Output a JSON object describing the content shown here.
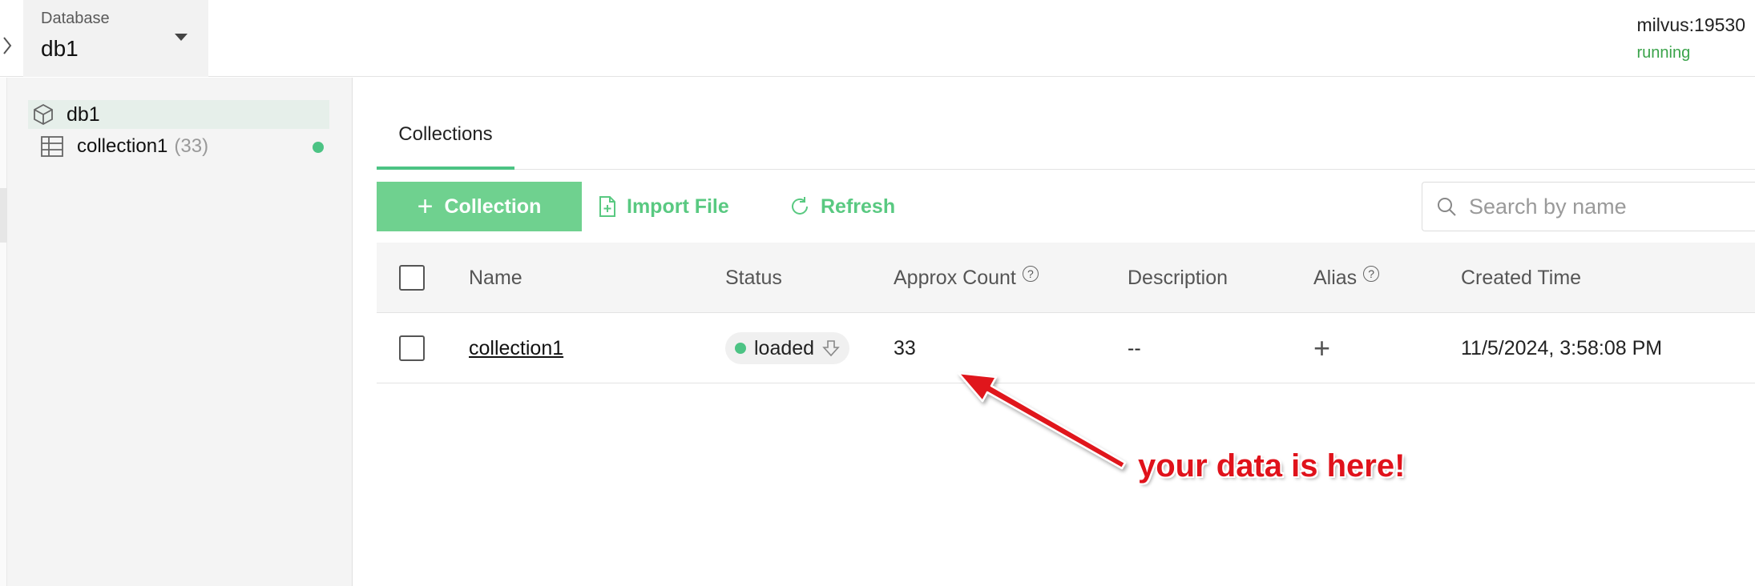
{
  "header": {
    "database_label": "Database",
    "database_value": "db1",
    "server_host": "milvus:19530",
    "server_status": "running"
  },
  "tree": {
    "database": "db1",
    "collections": [
      {
        "name": "collection1",
        "count": "(33)"
      }
    ]
  },
  "main": {
    "tab": "Collections",
    "toolbar": {
      "add_label": "Collection",
      "import_label": "Import File",
      "refresh_label": "Refresh",
      "search_placeholder": "Search by name"
    },
    "table": {
      "headers": {
        "name": "Name",
        "status": "Status",
        "count": "Approx Count",
        "description": "Description",
        "alias": "Alias",
        "created": "Created Time"
      },
      "rows": [
        {
          "name": "collection1",
          "status": "loaded",
          "count": "33",
          "description": "--",
          "created": "11/5/2024, 3:58:08 PM"
        }
      ]
    }
  },
  "annotation": {
    "text": "your data is here!"
  },
  "colors": {
    "accent": "#6fd18f",
    "accent_text": "#59c981",
    "loaded_dot": "#4cc384",
    "running": "#3aa34a",
    "annotation": "#e0121b"
  },
  "icons": {
    "collapse": "chevron-right-icon",
    "dropdown": "caret-down-icon",
    "database": "cube-icon",
    "collection": "table-grid-icon",
    "import": "file-plus-icon",
    "refresh": "refresh-icon",
    "search": "search-icon",
    "help": "help-circle-icon",
    "release": "release-arrow-icon",
    "alias_add": "plus-icon"
  }
}
